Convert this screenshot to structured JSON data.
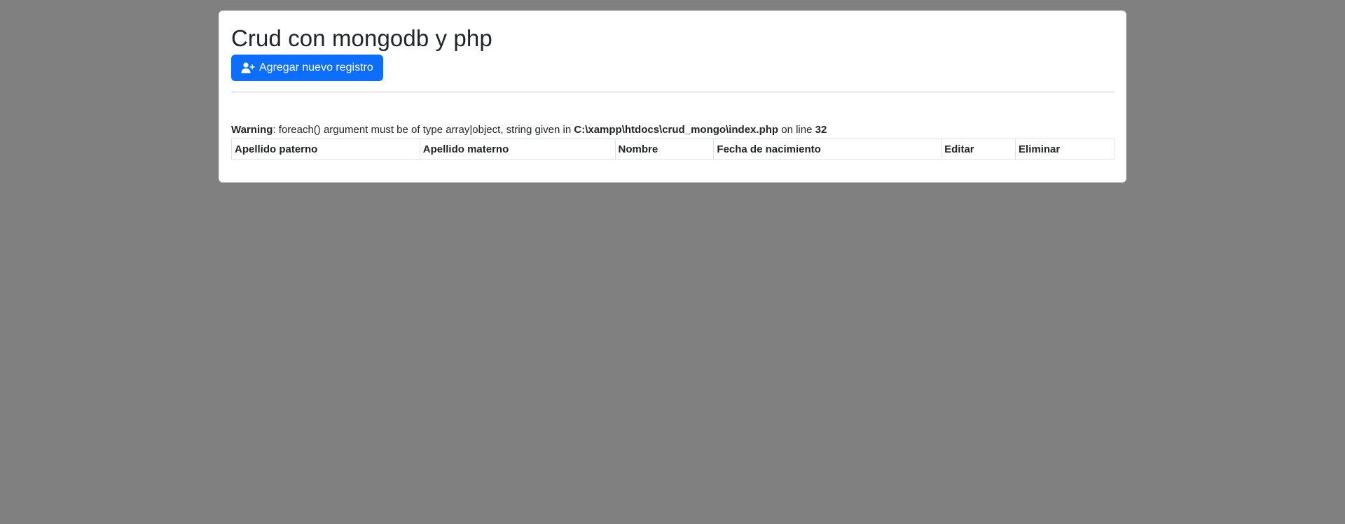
{
  "page": {
    "title": "Crud con mongodb y php"
  },
  "toolbar": {
    "add_icon": "user-plus-icon",
    "add_label": "Agregar nuevo registro"
  },
  "warning": {
    "label": "Warning",
    "message": ": foreach() argument must be of type array|object, string given in ",
    "file": "C:\\xampp\\htdocs\\crud_mongo\\index.php",
    "line_text": " on line ",
    "line": "32"
  },
  "table": {
    "columns": [
      "Apellido paterno",
      "Apellido materno",
      "Nombre",
      "Fecha de nacimiento",
      "Editar",
      "Eliminar"
    ]
  },
  "colors": {
    "background": "#808080",
    "card": "#ffffff",
    "primary": "#0d6efd",
    "text": "#212529"
  }
}
